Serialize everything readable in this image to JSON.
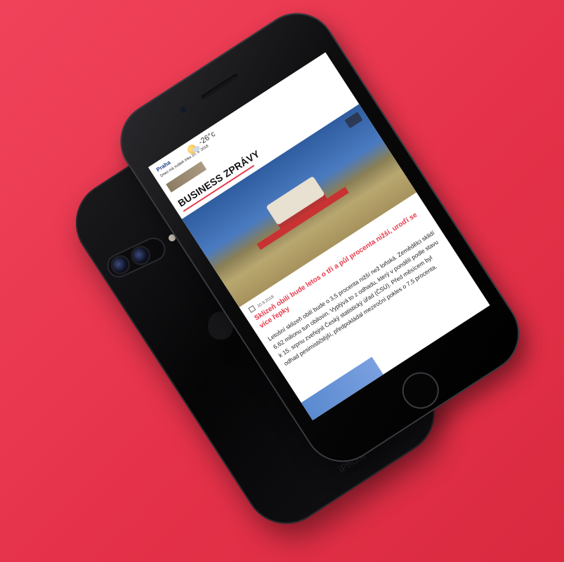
{
  "colors": {
    "background": "#ef3f56",
    "accent": "#e8394a",
    "phone": "#050506"
  },
  "back_phone": {
    "engraving": "iPhone"
  },
  "screen": {
    "weather": {
      "city": "Praha",
      "date": "Dnes má svátek Inka 10. 9. 2018",
      "temperature": "-26°c",
      "icon": "sun-cloud-icon"
    },
    "section_title": "BUSINESS ZPRÁVY",
    "article": {
      "date": "10.9.2018",
      "headline": "Sklizeň obilí bude letos o tři a půl procenta nižší, uroďí se více řepky",
      "body": "Letošní sklizeň obilí bude o 3,5 procenta nižší než loňská. Zemědělci sklidí 6,62 milionu tun obilovin. Vyplývá to z odhadu, který v pondělí podle stavu k 15. srpnu zveřejnil Český statistický úřad (ČSÚ). Před měsícem byl odhad pesimističtější, předpokládal meziroční pokles o 7,5 procenta."
    }
  }
}
